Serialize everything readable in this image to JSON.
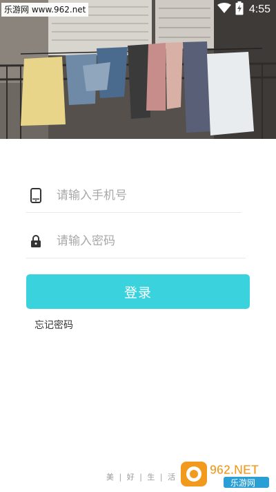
{
  "status_bar": {
    "watermark": "乐游网 www.962.net",
    "time": "4:55"
  },
  "login": {
    "phone_placeholder": "请输入手机号",
    "password_placeholder": "请输入密码",
    "login_button": "登录",
    "forgot_password": "忘记密码"
  },
  "footer": {
    "slogan": "美 | 好 | 生 | 活"
  },
  "watermark_bottom": {
    "brand": "962.NET",
    "sub": "乐游网"
  },
  "colors": {
    "accent": "#3ad3dd",
    "placeholder": "#a8a8a8"
  },
  "icons": [
    "wifi-icon",
    "battery-icon",
    "phone-icon",
    "lock-icon"
  ]
}
